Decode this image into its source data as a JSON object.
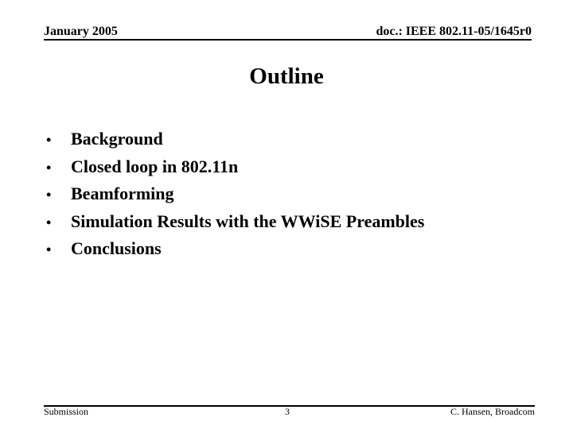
{
  "header": {
    "date": "January 2005",
    "doc_id": "doc.: IEEE 802.11-05/1645r0"
  },
  "slide": {
    "title": "Outline",
    "bullets": [
      "Background",
      "Closed loop in 802.11n",
      "Beamforming",
      "Simulation Results with the WWiSE Preambles",
      "Conclusions"
    ],
    "bullet_glyph": "•"
  },
  "footer": {
    "left": "Submission",
    "page_number": "3",
    "author": "C. Hansen, Broadcom"
  }
}
